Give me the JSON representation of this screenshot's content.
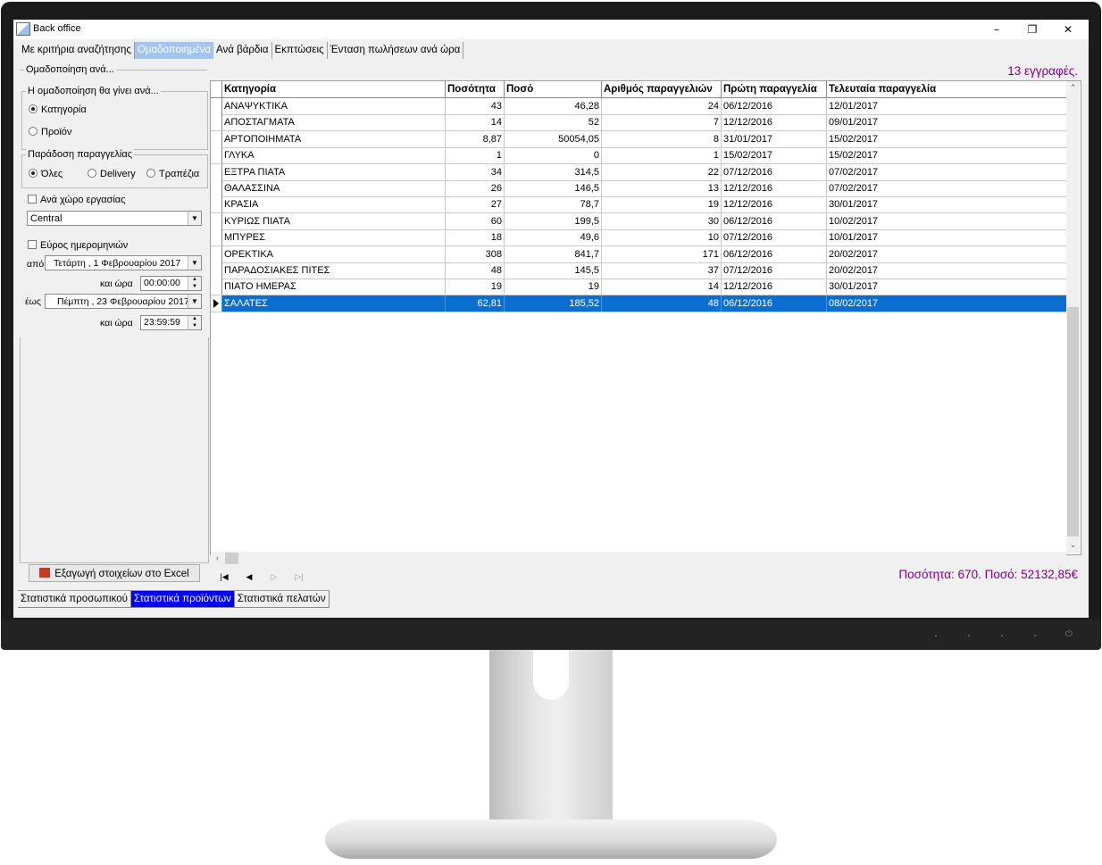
{
  "window": {
    "title": "Back office",
    "minimize": "–",
    "restore": "❐",
    "close": "✕"
  },
  "tabs": [
    {
      "label": "Με κριτήρια αναζήτησης"
    },
    {
      "label": "Ομαδοποιημένα"
    },
    {
      "label": "Ανά βάρδια"
    },
    {
      "label": "Εκπτώσεις"
    },
    {
      "label": "Ένταση πωλήσεων ανά ώρα"
    }
  ],
  "left": {
    "group_by_title": "Ομαδοποίηση ανά...",
    "grouping_title": "Η ομαδοποίηση θα γίνει ανά...",
    "grouping_options": [
      {
        "label": "Κατηγορία",
        "checked": true
      },
      {
        "label": "Προϊόν",
        "checked": false
      }
    ],
    "delivery_title": "Παράδοση παραγγελίας",
    "delivery_options": [
      {
        "label": "Όλες",
        "checked": true
      },
      {
        "label": "Delivery",
        "checked": false
      },
      {
        "label": "Τραπέζια",
        "checked": false
      }
    ],
    "workspace_label": "Ανά χώρο εργασίας",
    "workspace_value": "Central",
    "date_range_label": "Εύρος ημερομηνιών",
    "from_label": "από",
    "from_date": "Τετάρτη   ,   1 Φεβρουαρίου 2017",
    "from_time_label": "και ώρα",
    "from_time": "00:00:00",
    "to_label": "έως",
    "to_date": "Πέμπτη   , 23 Φεβρουαρίου 2017",
    "to_time_label": "και ώρα",
    "to_time": "23:59:59",
    "export_label": "Εξαγωγή στοιχείων στο Excel"
  },
  "records_count": "13 εγγραφές.",
  "grid": {
    "columns": [
      "Κατηγορία",
      "Ποσότητα",
      "Ποσό",
      "Αριθμός παραγγελιών",
      "Πρώτη παραγγελία",
      "Τελευταία παραγγελία"
    ],
    "rows": [
      [
        "ΑΝΑΨΥΚΤΙΚΑ",
        "43",
        "46,28",
        "24",
        "06/12/2016",
        "12/01/2017"
      ],
      [
        "ΑΠΟΣΤΑΓΜΑΤΑ",
        "14",
        "52",
        "7",
        "12/12/2016",
        "09/01/2017"
      ],
      [
        "ΑΡΤΟΠΟΙΗΜΑΤΑ",
        "8,87",
        "50054,05",
        "8",
        "31/01/2017",
        "15/02/2017"
      ],
      [
        "ΓΛΥΚΑ",
        "1",
        "0",
        "1",
        "15/02/2017",
        "15/02/2017"
      ],
      [
        "ΕΞΤΡΑ ΠΙΑΤΑ",
        "34",
        "314,5",
        "22",
        "07/12/2016",
        "07/02/2017"
      ],
      [
        "ΘΑΛΑΣΣΙΝΑ",
        "26",
        "146,5",
        "13",
        "12/12/2016",
        "07/02/2017"
      ],
      [
        "ΚΡΑΣΙΑ",
        "27",
        "78,7",
        "19",
        "12/12/2016",
        "30/01/2017"
      ],
      [
        "ΚΥΡΙΩΣ ΠΙΑΤΑ",
        "60",
        "199,5",
        "30",
        "06/12/2016",
        "10/02/2017"
      ],
      [
        "ΜΠΥΡΕΣ",
        "18",
        "49,6",
        "10",
        "07/12/2016",
        "10/01/2017"
      ],
      [
        "ΟΡΕΚΤΙΚΑ",
        "308",
        "841,7",
        "171",
        "06/12/2016",
        "20/02/2017"
      ],
      [
        "ΠΑΡΑΔΟΣΙΑΚΕΣ ΠΙΤΕΣ",
        "48",
        "145,5",
        "37",
        "07/12/2016",
        "20/02/2017"
      ],
      [
        "ΠΙΑΤΟ ΗΜΕΡΑΣ",
        "19",
        "19",
        "14",
        "12/12/2016",
        "30/01/2017"
      ],
      [
        "ΣΑΛΑΤΕΣ",
        "62,81",
        "185,52",
        "48",
        "06/12/2016",
        "08/02/2017"
      ]
    ],
    "selected_row": 12
  },
  "totals": "Ποσότητα: 670. Ποσό: 52132,85€",
  "bottom_tabs": [
    {
      "label": "Στατιστικά προσωπικού"
    },
    {
      "label": "Στατιστικά προϊόντων"
    },
    {
      "label": "Στατιστικά πελατών"
    }
  ],
  "colors": {
    "selection": "#0a6fd0",
    "active_tab": "#9fc5f0",
    "active_bottom_tab": "#0000f0",
    "summary_text": "#800080"
  }
}
